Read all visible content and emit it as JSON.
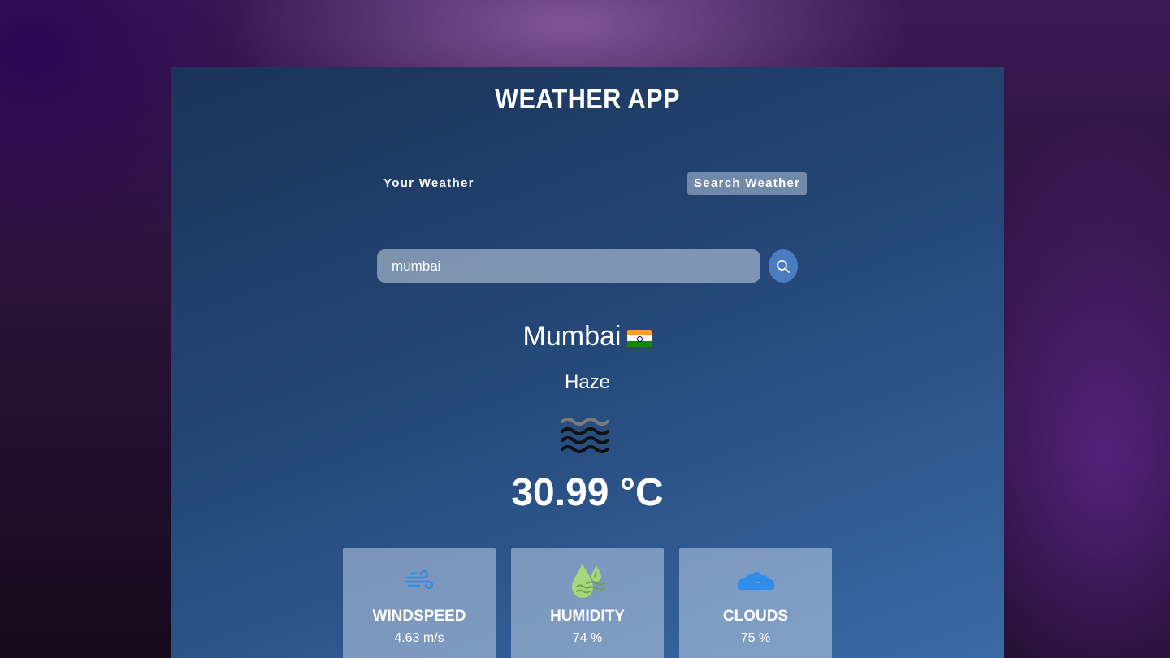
{
  "app": {
    "title": "WEATHER APP"
  },
  "tabs": {
    "your_weather": "Your Weather",
    "search_weather": "Search Weather"
  },
  "search": {
    "value": "mumbai",
    "icon": "search-icon"
  },
  "weather": {
    "city": "Mumbai",
    "flag": "india-flag",
    "condition": "Haze",
    "condition_icon": "haze-icon",
    "temperature": "30.99 °C"
  },
  "stats": [
    {
      "label": "WINDSPEED",
      "value": "4.63 m/s",
      "icon": "wind-icon"
    },
    {
      "label": "HUMIDITY",
      "value": "74 %",
      "icon": "humidity-icon"
    },
    {
      "label": "CLOUDS",
      "value": "75 %",
      "icon": "clouds-icon"
    }
  ],
  "colors": {
    "wind_icon": "#2b8ee0",
    "humidity_icon": "#a8d67a",
    "clouds_icon": "#2f8de8",
    "search_button": "#4b7cc2"
  }
}
